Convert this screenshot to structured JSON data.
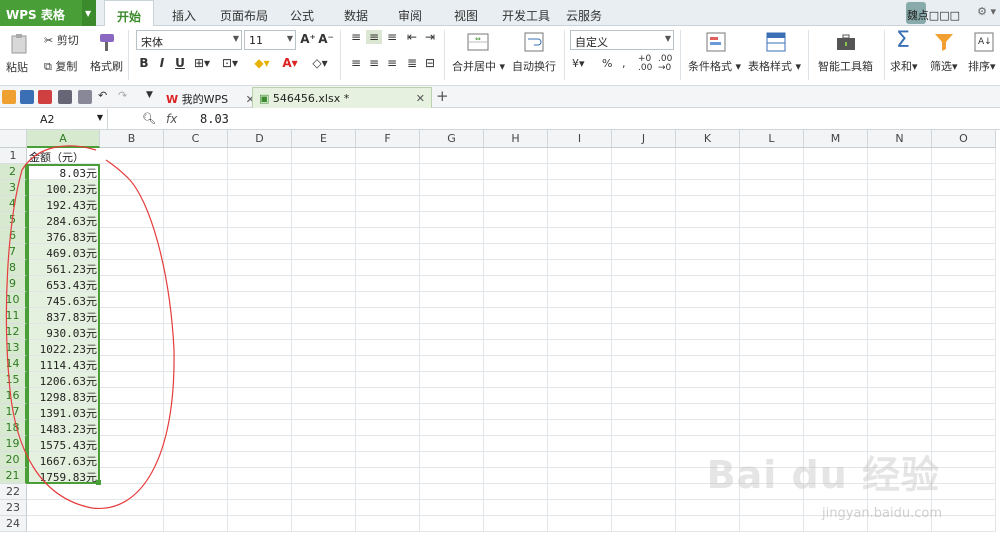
{
  "app": {
    "name": "WPS 表格",
    "user": "魏点□□□"
  },
  "menu_tabs": [
    "开始",
    "插入",
    "页面布局",
    "公式",
    "数据",
    "审阅",
    "视图",
    "开发工具",
    "云服务"
  ],
  "ribbon": {
    "paste": "粘贴",
    "cut": "剪切",
    "copy": "复制",
    "format_painter": "格式刷",
    "font_name": "宋体",
    "font_size": "11",
    "merge_center": "合并居中",
    "wrap_text": "自动换行",
    "number_format": "自定义",
    "percent": "%",
    "cond_format": "条件格式",
    "table_style": "表格样式",
    "smart_toolbox": "智能工具箱",
    "sum": "求和",
    "filter": "筛选",
    "sort": "排序"
  },
  "doc_tabs": [
    {
      "label": "我的WPS",
      "active": false
    },
    {
      "label": "546456.xlsx *",
      "active": true
    }
  ],
  "formula_bar": {
    "cell_ref": "A2",
    "fx": "fx",
    "value": "8.03"
  },
  "columns": [
    "A",
    "B",
    "C",
    "D",
    "E",
    "F",
    "G",
    "H",
    "I",
    "J",
    "K",
    "L",
    "M",
    "N",
    "O"
  ],
  "rows": [
    "1",
    "2",
    "3",
    "4",
    "5",
    "6",
    "7",
    "8",
    "9",
    "10",
    "11",
    "12",
    "13",
    "14",
    "15",
    "16",
    "17",
    "18",
    "19",
    "20",
    "21",
    "22",
    "23",
    "24"
  ],
  "column_a": [
    "金额（元）",
    "8.03元",
    "100.23元",
    "192.43元",
    "284.63元",
    "376.83元",
    "469.03元",
    "561.23元",
    "653.43元",
    "745.63元",
    "837.83元",
    "930.03元",
    "1022.23元",
    "1114.43元",
    "1206.63元",
    "1298.83元",
    "1391.03元",
    "1483.23元",
    "1575.43元",
    "1667.63元",
    "1759.83元"
  ],
  "watermark": {
    "main": "Bai du 经验",
    "sub": "jingyan.baidu.com"
  },
  "colors": {
    "brand_green": "#4a9e37",
    "annotation_red": "#e53b3b"
  }
}
